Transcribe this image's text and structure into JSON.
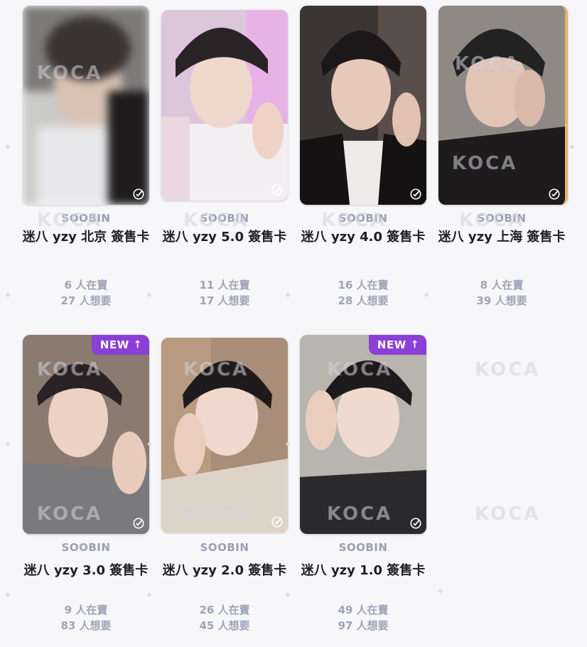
{
  "watermark_text": "KOCA",
  "cards": [
    {
      "member": "SOOBIN",
      "title": "迷八 yzy 北京 簽售卡",
      "selling": "6 人在賣",
      "wanting": "27 人想要",
      "is_new": false
    },
    {
      "member": "SOOBIN",
      "title": "迷八 yzy 5.0 簽售卡",
      "selling": "11 人在賣",
      "wanting": "17 人想要",
      "is_new": false
    },
    {
      "member": "SOOBIN",
      "title": "迷八 yzy 4.0 簽售卡",
      "selling": "16 人在賣",
      "wanting": "28 人想要",
      "is_new": false
    },
    {
      "member": "SOOBIN",
      "title": "迷八 yzy 上海 簽售卡",
      "selling": "8 人在賣",
      "wanting": "39 人想要",
      "is_new": false
    },
    {
      "member": "SOOBIN",
      "title": "迷八 yzy 3.0 簽售卡",
      "selling": "9 人在賣",
      "wanting": "83 人想要",
      "is_new": true,
      "badge": "NEW"
    },
    {
      "member": "SOOBIN",
      "title": "迷八 yzy 2.0 簽售卡",
      "selling": "26 人在賣",
      "wanting": "45 人想要",
      "is_new": false
    },
    {
      "member": "SOOBIN",
      "title": "迷八 yzy 1.0 簽售卡",
      "selling": "49 人在賣",
      "wanting": "97 人想要",
      "is_new": true,
      "badge": "NEW"
    }
  ],
  "colors": {
    "badge": "#8a3fd6",
    "member": "#9a9fb4",
    "title": "#1e1f24",
    "stat": "#9ea3b6"
  }
}
